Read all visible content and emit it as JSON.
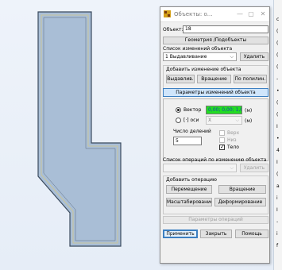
{
  "dialog": {
    "title": "Объекты: о...",
    "object_label": "Объект:",
    "object_value": "18",
    "geometry_button": "Геометрия /Подобъекты",
    "changes_list_label": "Список изменений объекта",
    "changes_combo_value": "1 Выдавливание",
    "delete_button": "Удалить",
    "add_change_group": "Добавить изменение объекта",
    "extrude_button": "Выдавлив.",
    "rotate_button": "Вращение",
    "polyline_button": "По полилин.",
    "params_header": "Параметры изменений объекта",
    "vector_label": "Вектор",
    "vector_value": "0,00; 0,00; 1,0",
    "vector_unit": "(м)",
    "axis_label": "[·] оси",
    "axis_combo_value": "X",
    "axis_unit": "(м)",
    "divisions_label": "Число делений",
    "divisions_value": "5",
    "top_label": "Верх",
    "bottom_label": "Низ",
    "body_label": "Тело",
    "ops_list_label": "Список операций по изменению объекта",
    "ops_delete_button": "Удалить",
    "add_operation_group": "Добавить операцию",
    "move_button": "Перемещение",
    "rotation_button": "Вращение",
    "scale_button": "Масштабирование",
    "deform_button": "Деформирование",
    "ops_params_button": "Параметры операций",
    "apply_button": "Применить",
    "close_button": "Закрыть",
    "help_button": "Помощь"
  },
  "right_strip_chars": [
    "с",
    "(",
    "(",
    "(",
    "(",
    "-",
    "•",
    "(",
    "(",
    "I",
    "•",
    "4",
    "I",
    "(",
    "a",
    "i",
    "I",
    "-",
    "i",
    "f"
  ],
  "colors": {
    "vector_highlight": "#22dd22",
    "params_header_bg": "#cfe5fb",
    "shape_fill": "#aabfd6",
    "shape_border": "#3f4f63"
  }
}
